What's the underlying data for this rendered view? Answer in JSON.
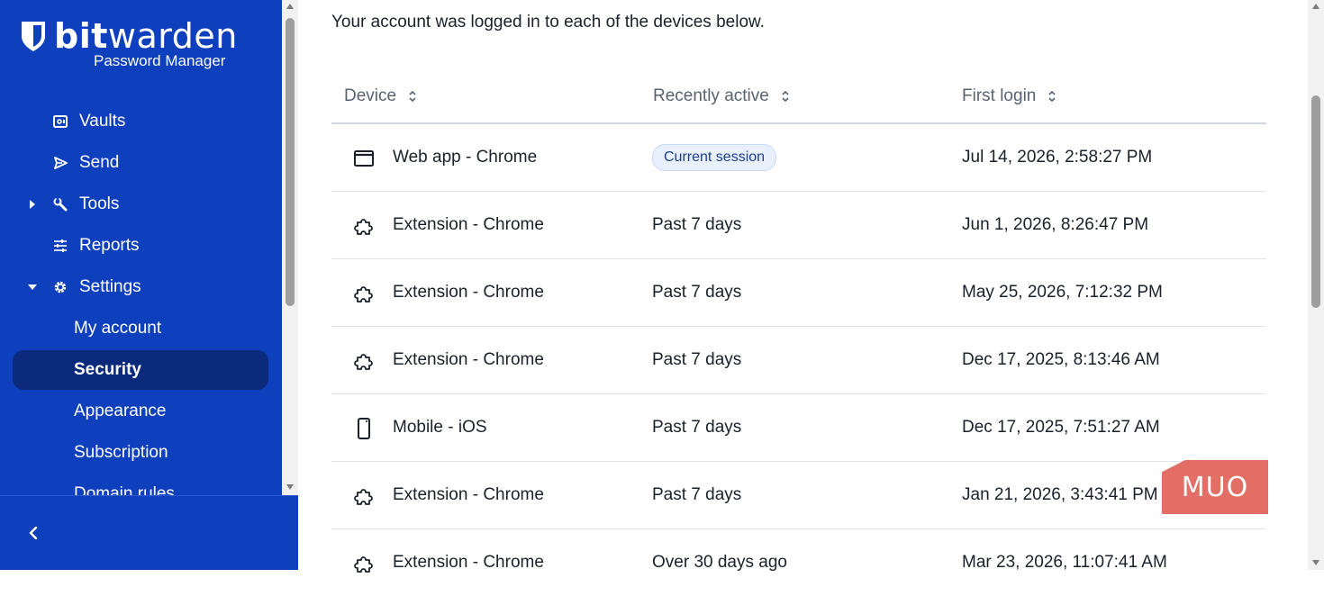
{
  "brand": {
    "name_bold": "bit",
    "name_light": "warden",
    "subtitle": "Password Manager"
  },
  "sidebar": {
    "items": [
      {
        "label": "Vaults",
        "icon": "vault-icon"
      },
      {
        "label": "Send",
        "icon": "send-icon"
      },
      {
        "label": "Tools",
        "icon": "wrench-icon",
        "caret": "collapsed"
      },
      {
        "label": "Reports",
        "icon": "sliders-icon"
      },
      {
        "label": "Settings",
        "icon": "gear-icon",
        "caret": "expanded"
      }
    ],
    "settings_subitems": [
      {
        "label": "My account"
      },
      {
        "label": "Security",
        "active": true
      },
      {
        "label": "Appearance"
      },
      {
        "label": "Subscription"
      },
      {
        "label": "Domain rules"
      }
    ]
  },
  "main": {
    "intro": "Your account was logged in to each of the devices below.",
    "table": {
      "columns": [
        "Device",
        "Recently active",
        "First login"
      ],
      "rows": [
        {
          "device": "Web app - Chrome",
          "icon": "browser-window-icon",
          "active": "Current session",
          "active_badge": true,
          "first_login": "Jul 14, 2026, 2:58:27 PM"
        },
        {
          "device": "Extension - Chrome",
          "icon": "puzzle-icon",
          "active": "Past 7 days",
          "first_login": "Jun 1, 2026, 8:26:47 PM"
        },
        {
          "device": "Extension - Chrome",
          "icon": "puzzle-icon",
          "active": "Past 7 days",
          "first_login": "May 25, 2026, 7:12:32 PM"
        },
        {
          "device": "Extension - Chrome",
          "icon": "puzzle-icon",
          "active": "Past 7 days",
          "first_login": "Dec 17, 2025, 8:13:46 AM"
        },
        {
          "device": "Mobile - iOS",
          "icon": "mobile-phone-icon",
          "active": "Past 7 days",
          "first_login": "Dec 17, 2025, 7:51:27 AM"
        },
        {
          "device": "Extension - Chrome",
          "icon": "puzzle-icon",
          "active": "Past 7 days",
          "first_login": "Jan 21, 2026, 3:43:41 PM"
        },
        {
          "device": "Extension - Chrome",
          "icon": "puzzle-icon",
          "active": "Over 30 days ago",
          "first_login": "Mar 23, 2026, 11:07:41 AM"
        }
      ]
    }
  },
  "watermark": "MUO",
  "colors": {
    "sidebar_bg": "#0e3fbd",
    "active_item_bg": "#0b2a7c",
    "badge_bg": "#e9f0fd",
    "badge_text": "#1c3f8d",
    "watermark_bg": "#e0625a"
  }
}
